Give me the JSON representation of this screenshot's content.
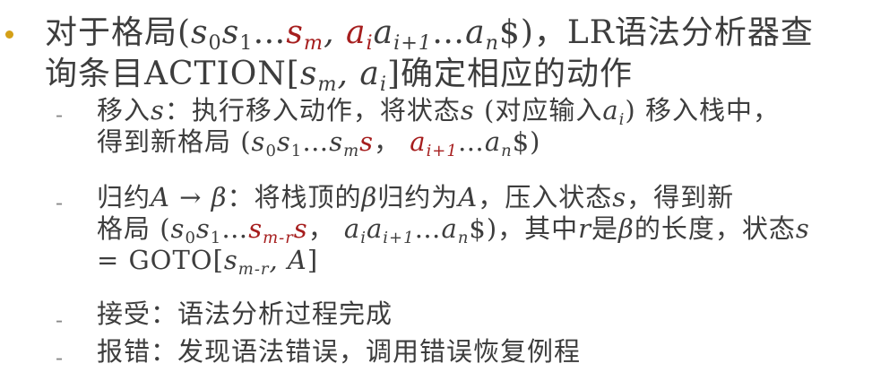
{
  "main": {
    "p1": "对于格局(",
    "s": "s",
    "s0": "0",
    "s1": "1",
    "ell1": "…",
    "sm": "m",
    "comma": ",",
    "a": "a",
    "ai": "i",
    "ai1": "i+1",
    "ell2": "…",
    "an": "n",
    "dollar_close": "$)，LR语法分析器查",
    "line2_a": "询条目ACTION[",
    "line2_comma": ", ",
    "line2_b": "]确定相应的动作"
  },
  "dash": "-",
  "items": [
    {
      "l1_a": "移入",
      "l1_b": "：执行移入动作，将状态",
      "l1_c": "(对应输入",
      "l1_d": ") 移入栈中，",
      "l2_a": "得到新格局 (",
      "l2_b": "，",
      "l2_c": "$)"
    },
    {
      "l1_a": "归约",
      "l1_A": "A",
      "l1_arrow": " → ",
      "l1_beta": "β",
      "l1_b": "：将栈顶的",
      "l1_c": "归约为",
      "l1_d": "，压入状态",
      "l1_e": "，得到新",
      "l2_a": "格局 (",
      "l2_mr": "m-r",
      "l2_b": "，",
      "l2_c": "$)，其中",
      "l2_r": "r",
      "l2_d": "是",
      "l2_e": "的长度，状态",
      "l3_a": "= GOTO[",
      "l3_mr": "m-r",
      "l3_b": ", ",
      "l3_c": "]"
    },
    {
      "text": "接受：语法分析过程完成"
    },
    {
      "text": "报错：发现语法错误，调用错误恢复例程"
    }
  ]
}
